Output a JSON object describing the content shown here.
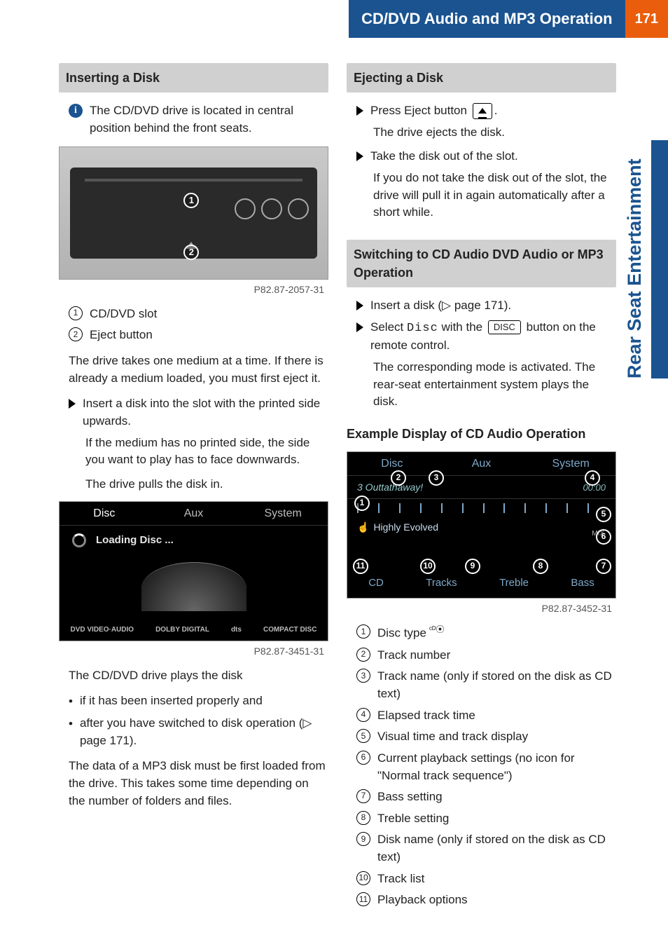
{
  "header": {
    "title": "CD/DVD Audio and MP3 Operation",
    "page_number": "171"
  },
  "side_tab": "Rear Seat Entertainment",
  "left": {
    "section1": {
      "heading": "Inserting a Disk",
      "info": "The CD/DVD drive is located in central position behind the front seats.",
      "fig1_label": "P82.87-2057-31",
      "callouts": [
        {
          "n": "1",
          "text": "CD/DVD slot"
        },
        {
          "n": "2",
          "text": "Eject button"
        }
      ],
      "p1": "The drive takes one medium at a time. If there is already a medium loaded, you must first eject it.",
      "step1": "Insert a disk into the slot with the printed side upwards.",
      "step1_sub1": "If the medium has no printed side, the side you want to play has to face downwards.",
      "step1_sub2": "The drive pulls the disk in.",
      "fig2": {
        "menu": [
          "Disc",
          "Aux",
          "System"
        ],
        "loading": "Loading Disc ...",
        "logos": [
          "DVD VIDEO·AUDIO",
          "DOLBY DIGITAL",
          "dts",
          "COMPACT DISC"
        ],
        "label": "P82.87-3451-31"
      },
      "p2": "The CD/DVD drive plays the disk",
      "bullets": [
        "if it has been inserted properly and",
        "after you have switched to disk operation (▷ page 171)."
      ],
      "p3": "The data of a MP3 disk must be first loaded from the drive. This takes some time depending on the number of folders and files."
    }
  },
  "right": {
    "section2": {
      "heading": "Ejecting a Disk",
      "step1_a": "Press Eject button ",
      "step1_b": ".",
      "step1_sub": "The drive ejects the disk.",
      "step2": "Take the disk out of the slot.",
      "step2_sub": "If you do not take the disk out of the slot, the drive will pull it in again automatically after a short while."
    },
    "section3": {
      "heading": "Switching to CD Audio DVD Audio or MP3 Operation",
      "step1": "Insert a disk (▷ page 171).",
      "step2_a": "Select ",
      "step2_disc": "Disc",
      "step2_b": " with the ",
      "step2_key": "DISC",
      "step2_c": " button on the remote control.",
      "step2_sub": "The corresponding mode is activated. The rear-seat entertainment system plays the disk."
    },
    "section4": {
      "heading": "Example Display of CD Audio Operation",
      "fig3": {
        "menu": [
          "Disc",
          "Aux",
          "System"
        ],
        "track_line": "3 Outtathaway!",
        "time": "00:00",
        "album": "Highly Evolved",
        "mix": "MIX",
        "bottom": [
          "CD",
          "Tracks",
          "Treble",
          "Bass"
        ],
        "label": "P82.87-3452-31",
        "calls": {
          "c1": "1",
          "c2": "2",
          "c3": "3",
          "c4": "4",
          "c5": "5",
          "c6": "6",
          "c7": "7",
          "c8": "8",
          "c9": "9",
          "c10": "10",
          "c11": "11"
        }
      },
      "callouts": [
        {
          "n": "1",
          "text": "Disc type",
          "icon": "CD"
        },
        {
          "n": "2",
          "text": "Track number"
        },
        {
          "n": "3",
          "text": "Track name (only if stored on the disk as CD text)"
        },
        {
          "n": "4",
          "text": "Elapsed track time"
        },
        {
          "n": "5",
          "text": "Visual time and track display"
        },
        {
          "n": "6",
          "text": "Current playback settings (no icon for \"Normal track sequence\")"
        },
        {
          "n": "7",
          "text": "Bass setting"
        },
        {
          "n": "8",
          "text": "Treble setting"
        },
        {
          "n": "9",
          "text": "Disk name (only if stored on the disk as CD text)"
        },
        {
          "n": "10",
          "text": "Track list"
        },
        {
          "n": "11",
          "text": "Playback options"
        }
      ]
    }
  }
}
